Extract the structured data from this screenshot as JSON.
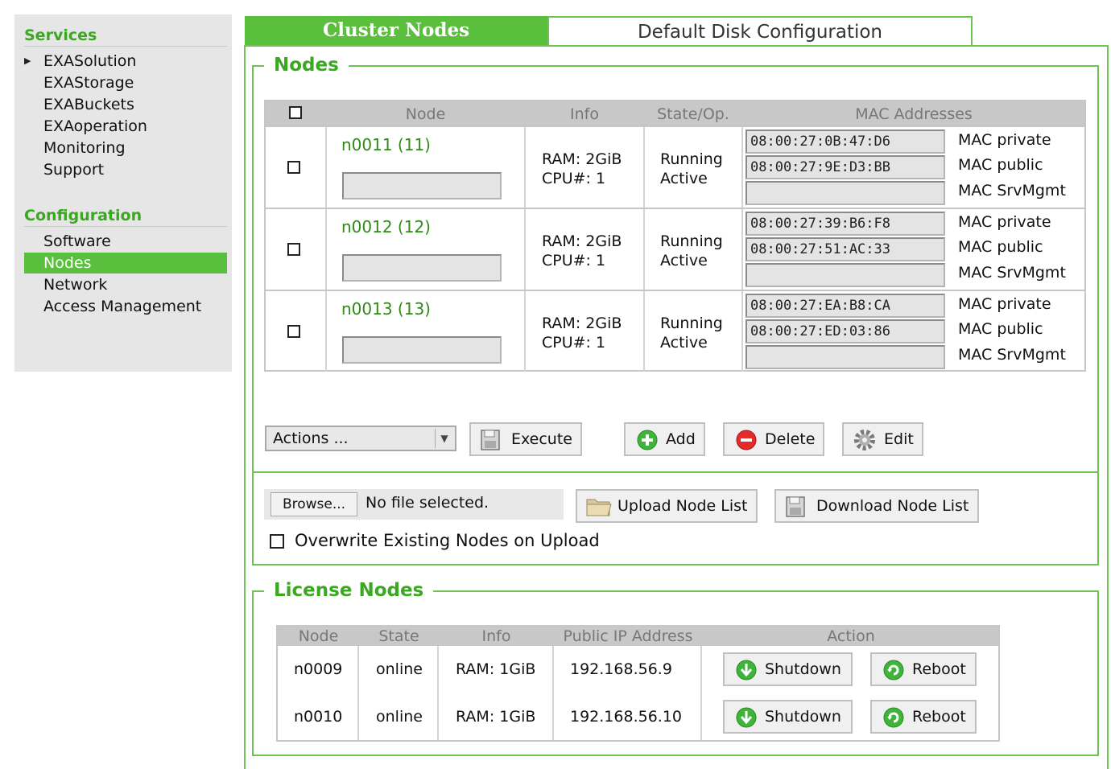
{
  "sidebar": {
    "services_title": "Services",
    "services": [
      "EXASolution",
      "EXAStorage",
      "EXABuckets",
      "EXAoperation",
      "Monitoring",
      "Support"
    ],
    "configuration_title": "Configuration",
    "configuration": [
      "Software",
      "Nodes",
      "Network",
      "Access Management"
    ],
    "active_item": "Nodes"
  },
  "tabs": {
    "active": "Cluster Nodes",
    "inactive": "Default Disk Configuration"
  },
  "nodes_section": {
    "title": "Nodes",
    "columns": [
      "Node",
      "Info",
      "State/Op.",
      "MAC Addresses"
    ],
    "rows": [
      {
        "name": "n0011 (11)",
        "ram": "RAM: 2GiB",
        "cpu": "CPU#: 1",
        "state": "Running",
        "op": "Active",
        "mac_private": "08:00:27:0B:47:D6",
        "mac_public": "08:00:27:9E:D3:BB",
        "mac_srvmgmt": ""
      },
      {
        "name": "n0012 (12)",
        "ram": "RAM: 2GiB",
        "cpu": "CPU#: 1",
        "state": "Running",
        "op": "Active",
        "mac_private": "08:00:27:39:B6:F8",
        "mac_public": "08:00:27:51:AC:33",
        "mac_srvmgmt": ""
      },
      {
        "name": "n0013 (13)",
        "ram": "RAM: 2GiB",
        "cpu": "CPU#: 1",
        "state": "Running",
        "op": "Active",
        "mac_private": "08:00:27:EA:B8:CA",
        "mac_public": "08:00:27:ED:03:86",
        "mac_srvmgmt": ""
      }
    ],
    "mac_labels": {
      "private": "MAC private",
      "public": "MAC public",
      "srvmgmt": "MAC SrvMgmt"
    },
    "actions_select": "Actions ...",
    "buttons": {
      "execute": "Execute",
      "add": "Add",
      "delete": "Delete",
      "edit": "Edit"
    },
    "browse": "Browse...",
    "file_status": "No file selected.",
    "upload": "Upload Node List",
    "download": "Download Node List",
    "overwrite": "Overwrite Existing Nodes on Upload"
  },
  "license_section": {
    "title": "License Nodes",
    "columns": [
      "Node",
      "State",
      "Info",
      "Public IP Address",
      "Action"
    ],
    "rows": [
      {
        "node": "n0009",
        "state": "online",
        "info": "RAM: 1GiB",
        "ip": "192.168.56.9"
      },
      {
        "node": "n0010",
        "state": "online",
        "info": "RAM: 1GiB",
        "ip": "192.168.56.10"
      }
    ],
    "shutdown": "Shutdown",
    "reboot": "Reboot"
  },
  "colors": {
    "accent": "#59bf3c",
    "accent_text": "#3aa820",
    "link": "#2f8a18",
    "header_gray": "#c8c8c8"
  }
}
